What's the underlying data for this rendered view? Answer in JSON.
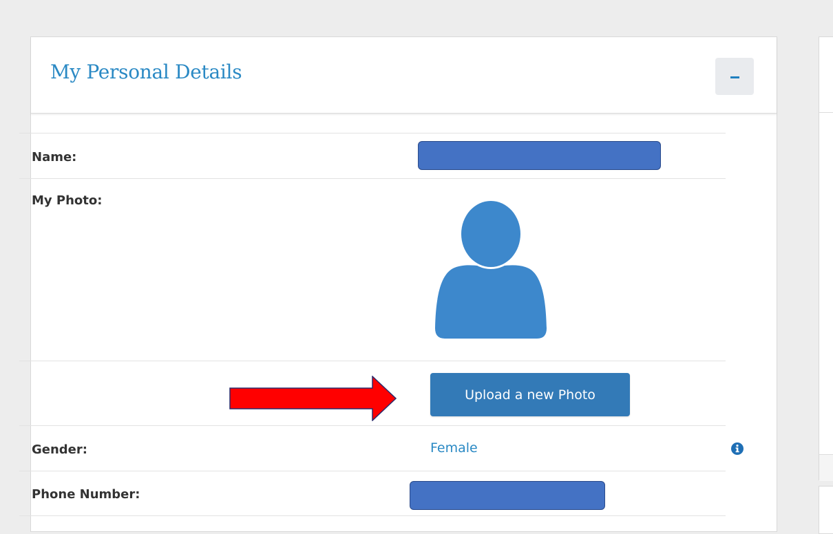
{
  "panel": {
    "title": "My Personal Details",
    "collapse_label": "−"
  },
  "fields": {
    "name_label": "Name:",
    "photo_label": "My Photo:",
    "gender_label": "Gender:",
    "gender_value": "Female",
    "phone_label": "Phone Number:"
  },
  "actions": {
    "upload_photo_label": "Upload a new Photo"
  },
  "icons": {
    "avatar": "user-silhouette-icon",
    "info": "info-circle-icon",
    "arrow": "red-right-arrow",
    "collapse": "minus-icon"
  },
  "colors": {
    "accent": "#2a89c4",
    "button": "#337ab7",
    "avatar": "#3d88cc",
    "redaction": "#4472c4",
    "arrow": "#ff0000"
  }
}
